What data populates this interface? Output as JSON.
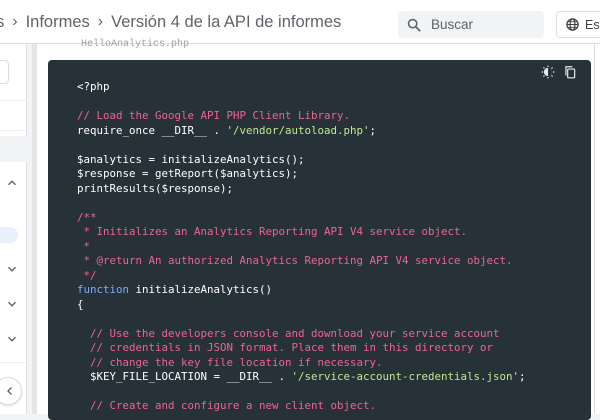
{
  "header": {
    "breadcrumb": [
      {
        "label": "s"
      },
      {
        "label": "Informes"
      },
      {
        "label": "Versión 4 de la API de informes"
      }
    ],
    "search_placeholder": "Buscar",
    "language_label": "Es"
  },
  "code": {
    "caption": "HelloAnalytics.php",
    "lines": [
      [
        {
          "t": "<?php",
          "c": "plain"
        }
      ],
      [],
      [
        {
          "t": "// Load the Google API PHP Client Library.",
          "c": "comment"
        }
      ],
      [
        {
          "t": "require_once __DIR__ . ",
          "c": "plain"
        },
        {
          "t": "'/vendor/autoload.php'",
          "c": "string"
        },
        {
          "t": ";",
          "c": "plain"
        }
      ],
      [],
      [
        {
          "t": "$analytics = initializeAnalytics();",
          "c": "plain"
        }
      ],
      [
        {
          "t": "$response = getReport($analytics);",
          "c": "plain"
        }
      ],
      [
        {
          "t": "printResults($response);",
          "c": "plain"
        }
      ],
      [],
      [
        {
          "t": "/**",
          "c": "comment"
        }
      ],
      [
        {
          "t": " * Initializes an Analytics Reporting API V4 service object.",
          "c": "comment"
        }
      ],
      [
        {
          "t": " *",
          "c": "comment"
        }
      ],
      [
        {
          "t": " * @return An authorized Analytics Reporting API V4 service object.",
          "c": "comment"
        }
      ],
      [
        {
          "t": " */",
          "c": "comment"
        }
      ],
      [
        {
          "t": "function",
          "c": "keyword"
        },
        {
          "t": " initializeAnalytics()",
          "c": "plain"
        }
      ],
      [
        {
          "t": "{",
          "c": "plain"
        }
      ],
      [],
      [
        {
          "t": "  // Use the developers console and download your service account",
          "c": "comment"
        }
      ],
      [
        {
          "t": "  // credentials in JSON format. Place them in this directory or",
          "c": "comment"
        }
      ],
      [
        {
          "t": "  // change the key file location if necessary.",
          "c": "comment"
        }
      ],
      [
        {
          "t": "  $KEY_FILE_LOCATION = __DIR__ . ",
          "c": "plain"
        },
        {
          "t": "'/service-account-credentials.json'",
          "c": "string"
        },
        {
          "t": ";",
          "c": "plain"
        }
      ],
      [],
      [
        {
          "t": "  // Create and configure a new client object.",
          "c": "comment"
        }
      ]
    ]
  },
  "icons": {
    "search": "search-icon",
    "language": "globe-icon",
    "theme": "brightness-icon",
    "copy": "copy-icon",
    "chevrons": [
      "chevron-up-icon",
      "chevron-down-icon",
      "chevron-down-icon",
      "chevron-down-icon"
    ],
    "collapse": "chevron-left-icon"
  },
  "colors": {
    "code_background": "#263238",
    "comment": "#f06292",
    "string": "#c3e88d",
    "keyword": "#82aaff"
  }
}
